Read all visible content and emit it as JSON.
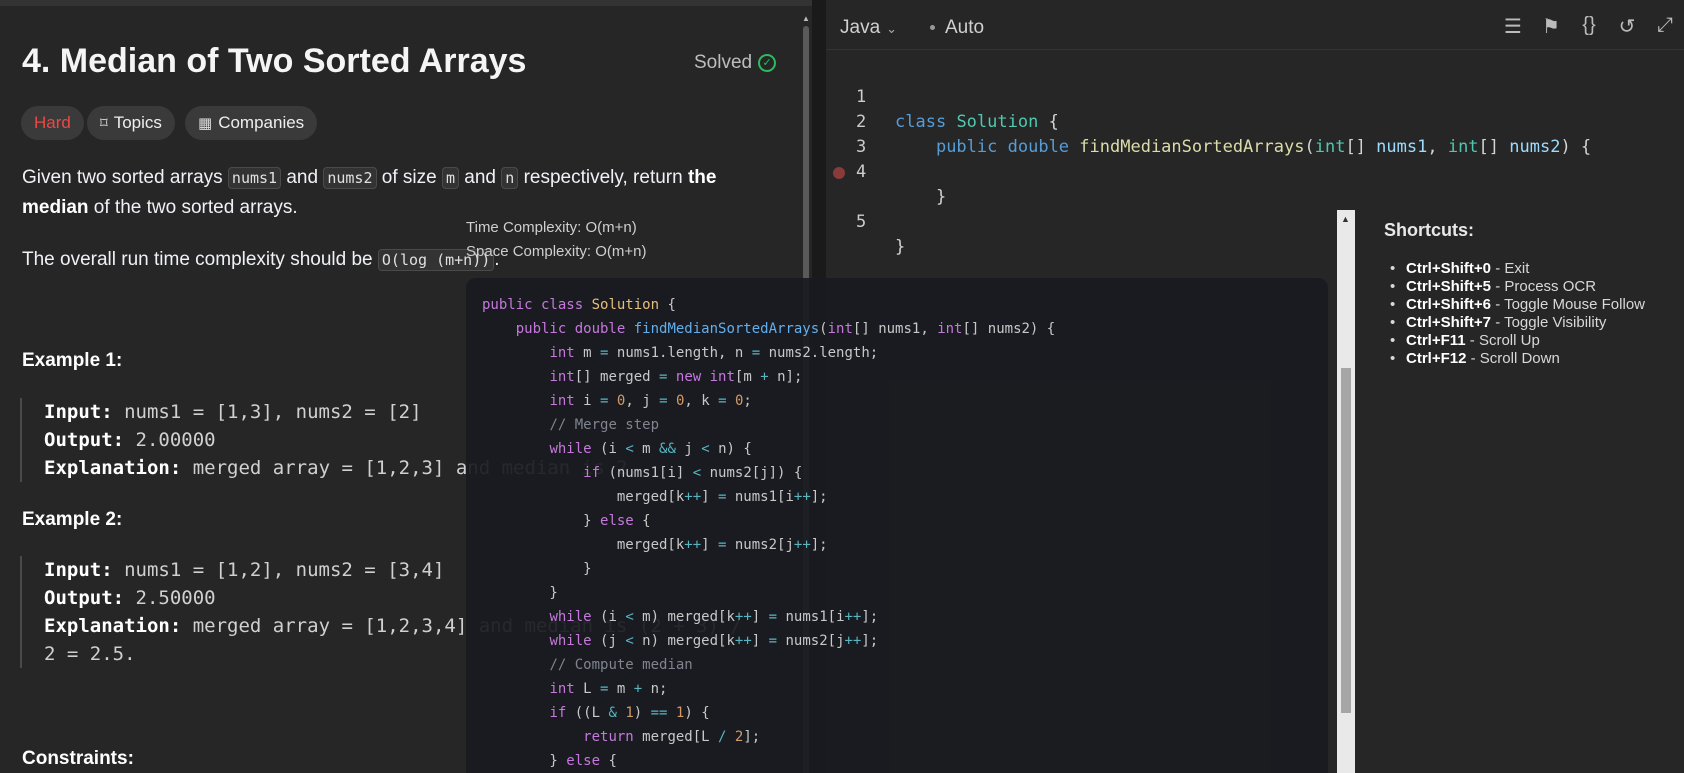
{
  "problem": {
    "title": "4. Median of Two Sorted Arrays",
    "status": "Solved",
    "tags": [
      "Hard",
      "Topics",
      "Companies"
    ],
    "desc_p1": [
      "Given two sorted arrays ",
      "nums1",
      " and ",
      "nums2",
      " of size ",
      "m",
      " and ",
      "n",
      " respectively, return ",
      "the median",
      " of the two sorted arrays."
    ],
    "desc_p2": [
      "The overall run time complexity should be ",
      "O(log (m+n))",
      "."
    ],
    "examples": [
      {
        "title": "Example 1:",
        "input": "nums1 = [1,3], nums2 = [2]",
        "output": "2.00000",
        "explanation": "merged array = [1,2,3] and median is 2."
      },
      {
        "title": "Example 2:",
        "input": "nums1 = [1,2], nums2 = [3,4]",
        "output": "2.50000",
        "explanation": "merged array = [1,2,3,4] and median is (2 + 3) /",
        "explanation2": "2 = 2.5."
      }
    ],
    "labels": {
      "input": "Input:",
      "output": "Output:",
      "explanation": "Explanation:"
    },
    "constraints_title": "Constraints:"
  },
  "editor": {
    "language": "Java",
    "mode": "Auto",
    "lines": [
      {
        "n": "1",
        "text": "class Solution {"
      },
      {
        "n": "2",
        "text": "    public double findMedianSortedArrays(int[] nums1, int[] nums2) {"
      },
      {
        "n": "3",
        "text": ""
      },
      {
        "n": "4",
        "text": "    }"
      },
      {
        "n": "5",
        "text": "}"
      }
    ]
  },
  "overlay": {
    "time_complexity": "Time Complexity: O(m+n)",
    "space_complexity": "Space Complexity: O(m+n)",
    "code": [
      "public class Solution {",
      "    public double findMedianSortedArrays(int[] nums1, int[] nums2) {",
      "        int m = nums1.length, n = nums2.length;",
      "        int[] merged = new int[m + n];",
      "        int i = 0, j = 0, k = 0;",
      "        // Merge step",
      "        while (i < m && j < n) {",
      "            if (nums1[i] < nums2[j]) {",
      "                merged[k++] = nums1[i++];",
      "            } else {",
      "                merged[k++] = nums2[j++];",
      "            }",
      "        }",
      "        while (i < m) merged[k++] = nums1[i++];",
      "        while (j < n) merged[k++] = nums2[j++];",
      "        // Compute median",
      "        int L = m + n;",
      "        if ((L & 1) == 1) {",
      "            return merged[L / 2];",
      "        } else {"
    ]
  },
  "shortcuts": {
    "title": "Shortcuts:",
    "items": [
      {
        "keys": "Ctrl+Shift+0",
        "action": " - Exit"
      },
      {
        "keys": "Ctrl+Shift+5",
        "action": " - Process OCR"
      },
      {
        "keys": "Ctrl+Shift+6",
        "action": " - Toggle Mouse Follow"
      },
      {
        "keys": "Ctrl+Shift+7",
        "action": " - Toggle Visibility"
      },
      {
        "keys": "Ctrl+F11",
        "action": " - Scroll Up"
      },
      {
        "keys": "Ctrl+F12",
        "action": " - Scroll Down"
      }
    ]
  }
}
